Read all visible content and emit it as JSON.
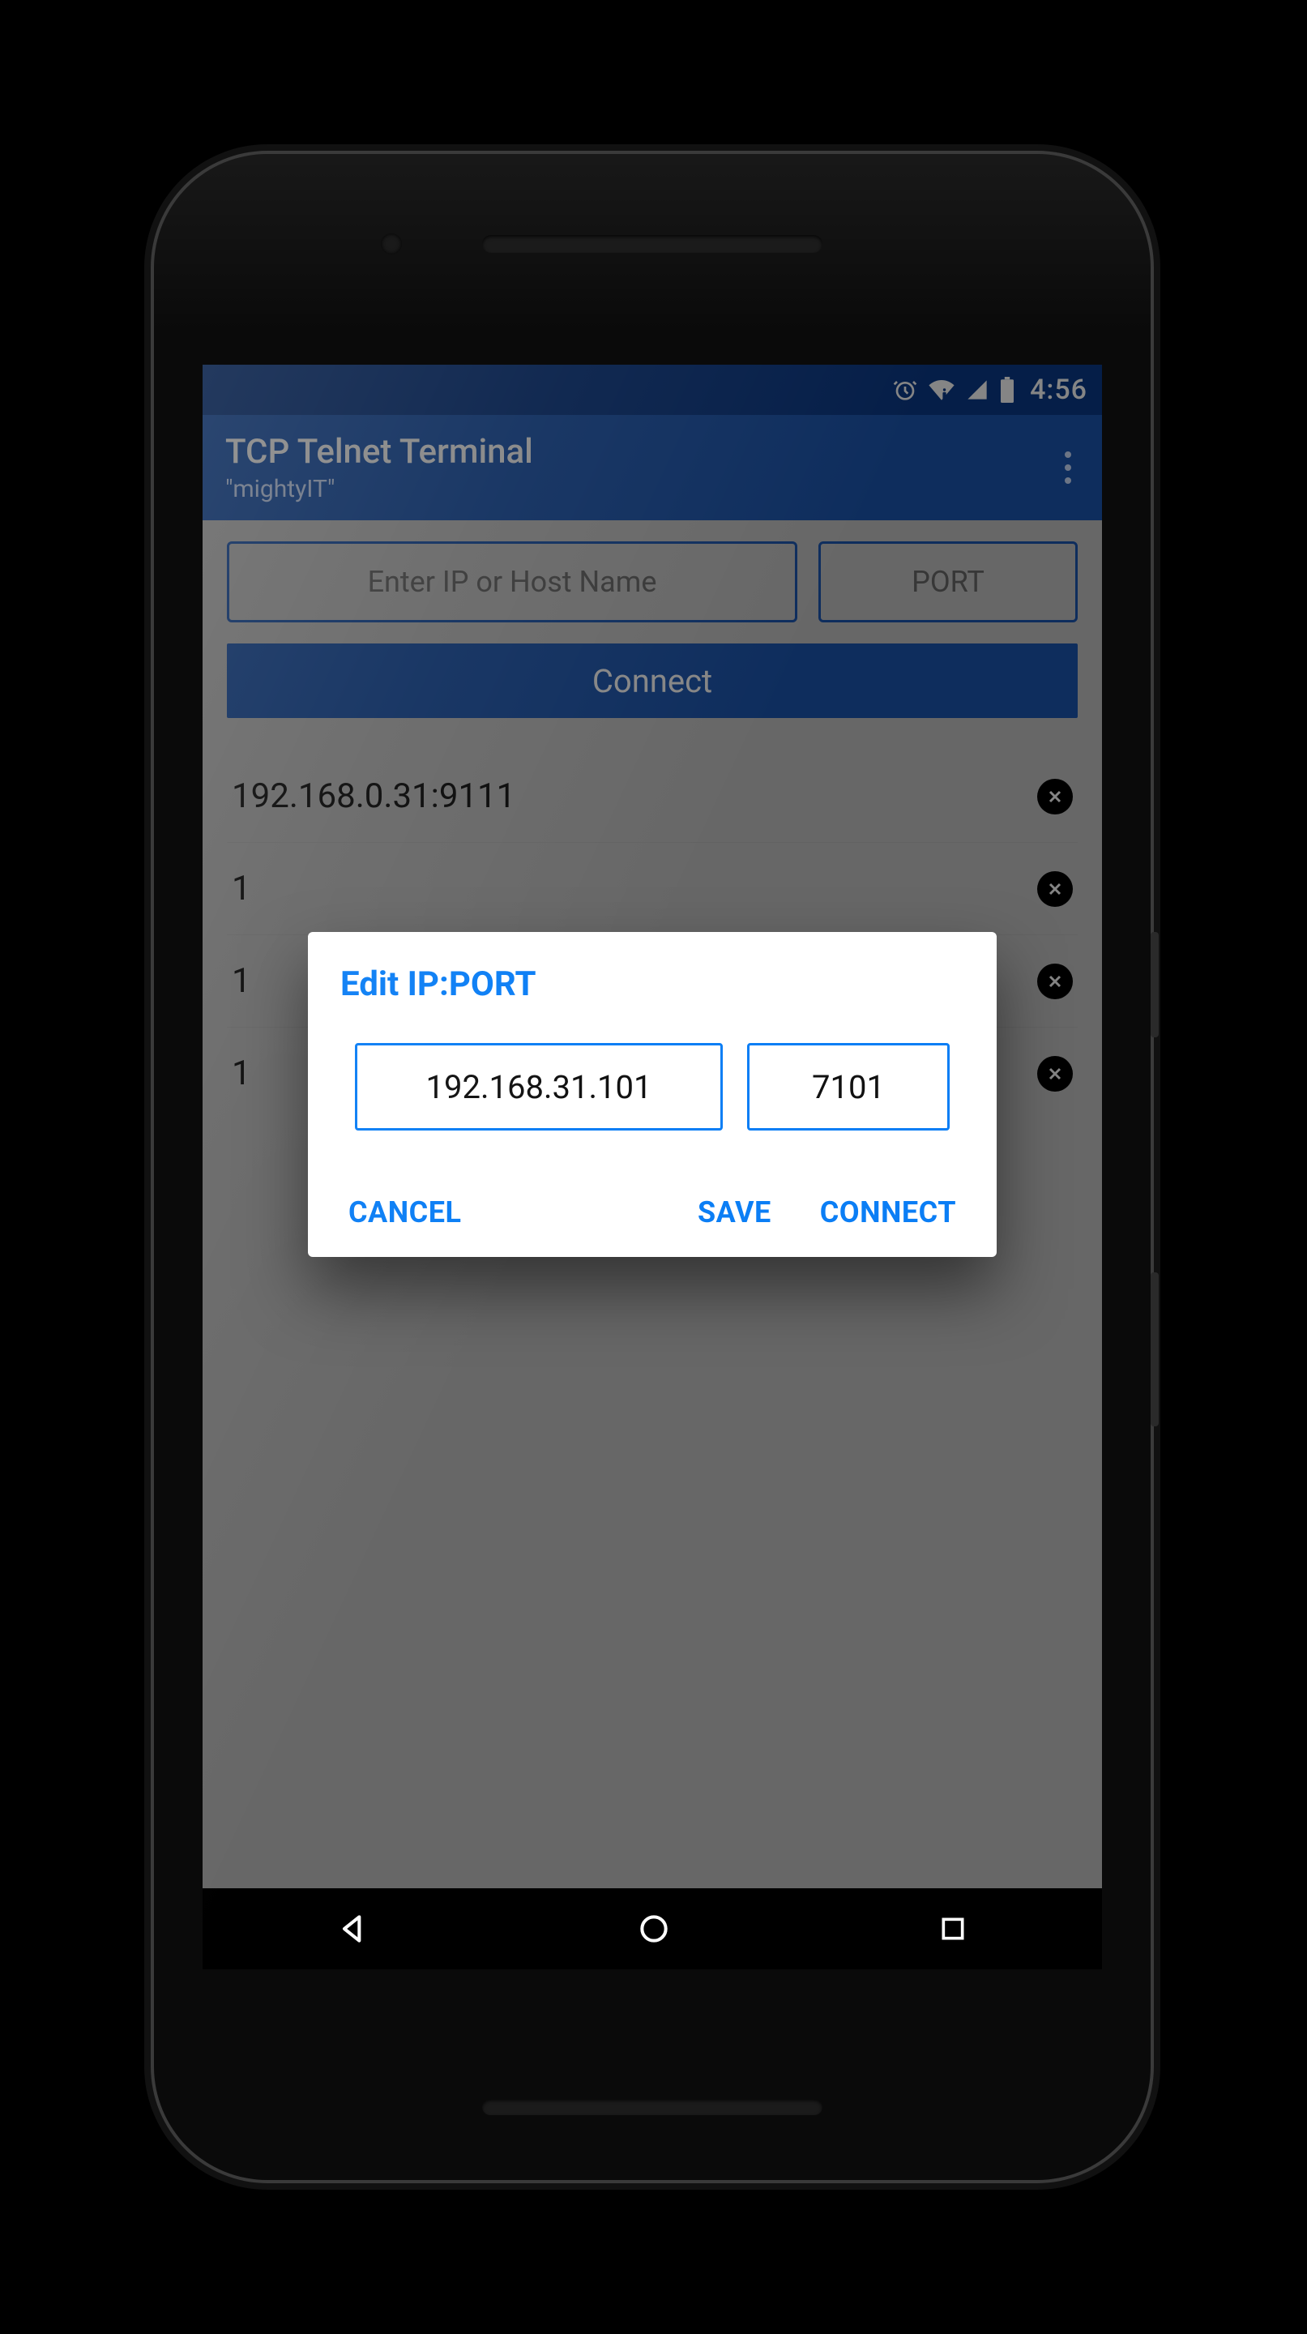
{
  "statusbar": {
    "time": "4:56"
  },
  "appbar": {
    "title": "TCP Telnet Terminal",
    "subtitle": "\"mightyIT\""
  },
  "main": {
    "ip_placeholder": "Enter IP or Host Name",
    "port_placeholder": "PORT",
    "connect_label": "Connect",
    "saved": [
      {
        "text": "192.168.0.31:9111"
      },
      {
        "text": "1"
      },
      {
        "text": "1"
      },
      {
        "text": "1"
      }
    ]
  },
  "dialog": {
    "title": "Edit IP:PORT",
    "ip_value": "192.168.31.101",
    "port_value": "7101",
    "cancel_label": "CANCEL",
    "save_label": "SAVE",
    "connect_label": "CONNECT"
  }
}
